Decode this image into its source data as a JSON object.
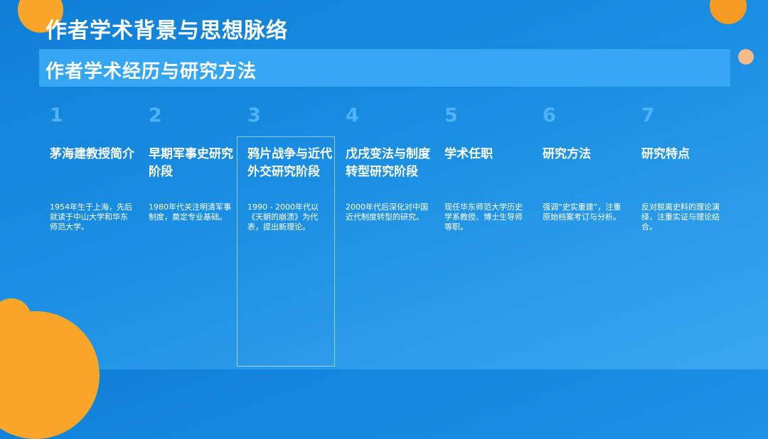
{
  "title": "作者学术背景与思想脉络",
  "subtitle": "作者学术经历与研究方法",
  "columns": [
    {
      "number": "1",
      "heading": "茅海建教授简介",
      "text": "1954年生于上海，先后就读于中山大学和华东师范大学。"
    },
    {
      "number": "2",
      "heading": "早期军事史研究阶段",
      "text": "1980年代关注明清军事制度，奠定专业基础。"
    },
    {
      "number": "3",
      "heading": "鸦片战争与近代外交研究阶段",
      "text": "1990 - 2000年代以《天朝的崩溃》为代表，提出新理论。"
    },
    {
      "number": "4",
      "heading": "戊戌变法与制度转型研究阶段",
      "text": "2000年代后深化对中国近代制度转型的研究。"
    },
    {
      "number": "5",
      "heading": "学术任职",
      "text": "现任华东师范大学历史学系教授、博士生导师等职。"
    },
    {
      "number": "6",
      "heading": "研究方法",
      "text": "强调“史实重建”，注重原始档案考订与分析。"
    },
    {
      "number": "7",
      "heading": "研究特点",
      "text": "反对脱离史料的理论演绎，注重实证与理论结合。"
    }
  ],
  "colors": {
    "accent": "#f8a52a",
    "bar": "#35a6f2",
    "number": "#4fb3f7"
  }
}
